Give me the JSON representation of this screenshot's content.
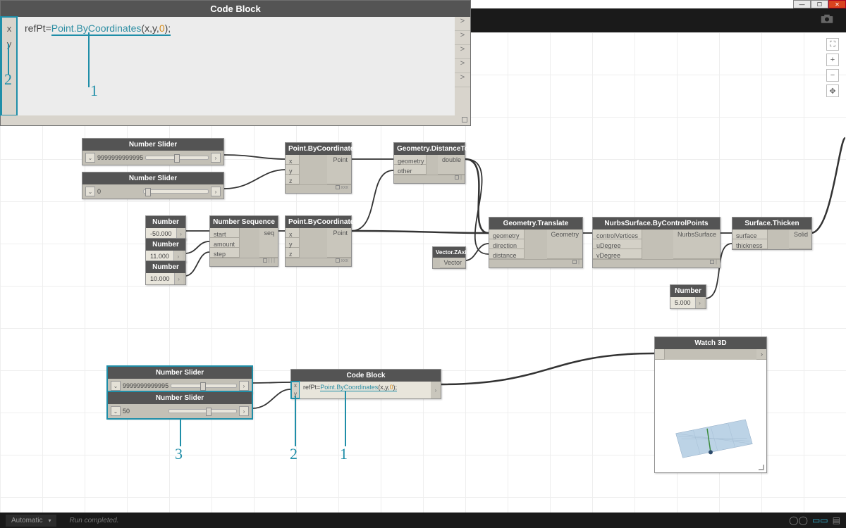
{
  "window": {
    "min": "—",
    "max": "☐",
    "close": "✕"
  },
  "zoom_panel": {
    "title": "Code Block",
    "ports_in": [
      "x",
      "y"
    ],
    "code_prefix": "refPt=",
    "code_fn": "Point.ByCoordinates",
    "code_args_open": "(",
    "code_arg1": "x",
    "code_comma1": ",",
    "code_arg2": "y",
    "code_comma2": ",",
    "code_argnum": "0",
    "code_args_close": ");",
    "out_rows": [
      ">",
      ">",
      ">",
      ">",
      ">"
    ]
  },
  "callouts_top": {
    "one": "1",
    "two": "2"
  },
  "graph": {
    "slider1": {
      "title": "Number Slider",
      "value": "9999999999995"
    },
    "slider2": {
      "title": "Number Slider",
      "value": "0"
    },
    "pbc_top": {
      "title": "Point.ByCoordinates",
      "in": [
        "x",
        "y",
        "z"
      ],
      "out": "Point",
      "footer": "xxx"
    },
    "distto": {
      "title": "Geometry.DistanceTo",
      "in": [
        "geometry",
        "other"
      ],
      "out": "double"
    },
    "num_a": {
      "title": "Number",
      "value": "-50.000"
    },
    "num_b": {
      "title": "Number",
      "value": "11.000"
    },
    "num_c": {
      "title": "Number",
      "value": "10.000"
    },
    "seq": {
      "title": "Number Sequence",
      "in": [
        "start",
        "amount",
        "step"
      ],
      "out": "seq",
      "footer": "| | |"
    },
    "pbc_mid": {
      "title": "Point.ByCoordinates",
      "in": [
        "x",
        "y",
        "z"
      ],
      "out": "Point",
      "footer": "xxx"
    },
    "vzaxis": {
      "title": "Vector.ZAxis",
      "out": "Vector"
    },
    "gtranslate": {
      "title": "Geometry.Translate",
      "in": [
        "geometry",
        "direction",
        "distance"
      ],
      "out": "Geometry"
    },
    "nurbs": {
      "title": "NurbsSurface.ByControlPoints",
      "in": [
        "controlVertices",
        "uDegree",
        "vDegree"
      ],
      "out": "NurbsSurface"
    },
    "thicken": {
      "title": "Surface.Thicken",
      "in": [
        "surface",
        "thickness"
      ],
      "out": "Solid"
    },
    "num_d": {
      "title": "Number",
      "value": "5.000"
    },
    "slider3": {
      "title": "Number Slider",
      "value": "9999999999995"
    },
    "slider4": {
      "title": "Number Slider",
      "value": "50"
    },
    "codeblock": {
      "title": "Code Block",
      "in": [
        "x",
        "y"
      ],
      "code_prefix": "refPt=",
      "code_fn": "Point.ByCoordinates",
      "code_mid": "(x,y,",
      "code_num": "0",
      "code_end": ");"
    },
    "watch3d": {
      "title": "Watch 3D"
    }
  },
  "callouts_bottom": {
    "one": "1",
    "two": "2",
    "three": "3"
  },
  "zoom_controls": {
    "fit": "⛶",
    "plus": "+",
    "minus": "−",
    "pan": "✥"
  },
  "status": {
    "mode": "Automatic",
    "msg": "Run completed."
  }
}
